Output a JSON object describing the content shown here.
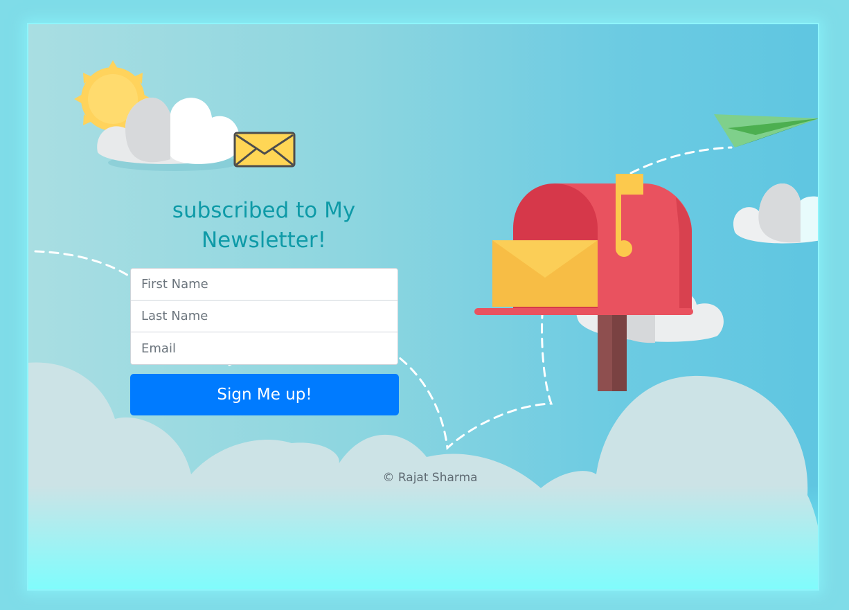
{
  "page": {
    "title": "subscribed to My Newsletter!",
    "footer": "© Rajat Sharma"
  },
  "form": {
    "first_name_placeholder": "First Name",
    "last_name_placeholder": "Last Name",
    "email_placeholder": "Email",
    "submit_label": "Sign Me up!"
  },
  "colors": {
    "accent": "#007bff",
    "title": "#0e9aa7",
    "background": "#7fdce8",
    "frame_glow": "#8ff5fb"
  },
  "icons": {
    "envelope": "envelope-icon",
    "mailbox": "mailbox-icon",
    "paper_plane": "paper-plane-icon",
    "sun": "sun-icon",
    "cloud": "cloud-icon"
  }
}
